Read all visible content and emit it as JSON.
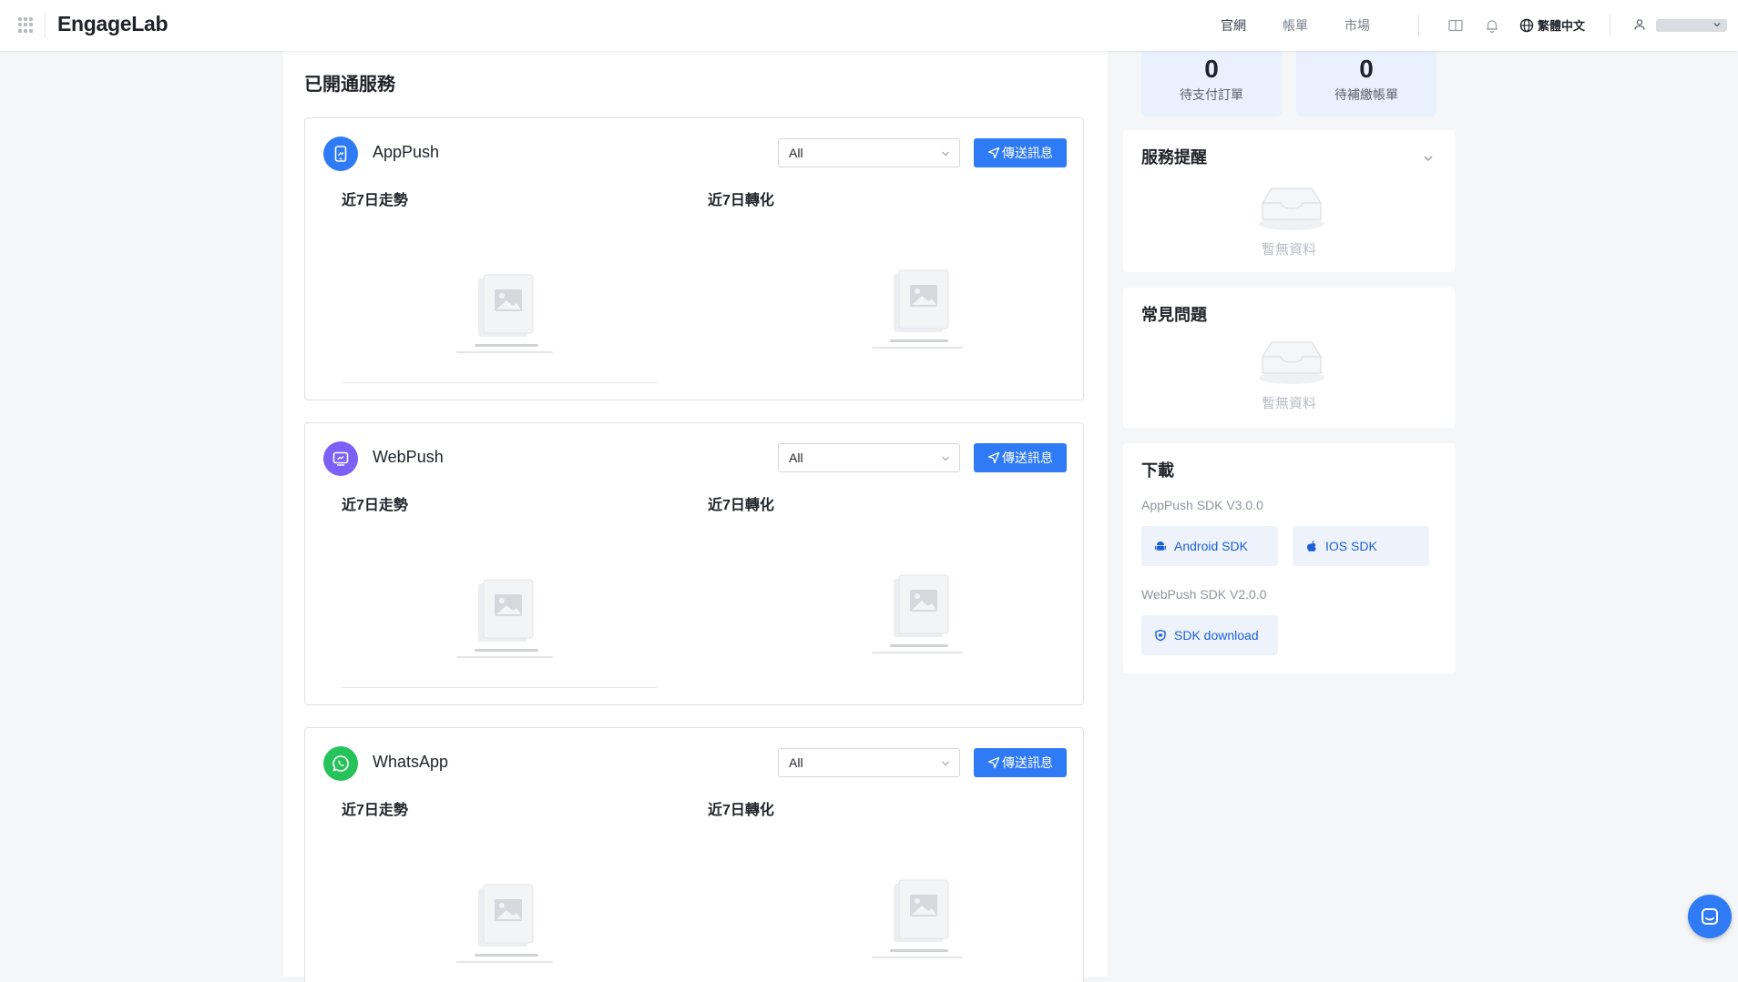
{
  "app": {
    "logo": "EngageLab"
  },
  "topbar": {
    "links": [
      "官網",
      "帳單",
      "市場"
    ],
    "language": "繁體中文",
    "icons": [
      "apps-grid-icon",
      "book-icon",
      "bell-icon",
      "globe-icon",
      "user-icon"
    ]
  },
  "main": {
    "title": "已開通服務",
    "services": [
      {
        "name": "AppPush",
        "icon": "apppush-icon",
        "color": "#2f7af5",
        "filter": "All",
        "send_label": "傳送訊息",
        "trend_label": "近7日走勢",
        "conversion_label": "近7日轉化"
      },
      {
        "name": "WebPush",
        "icon": "webpush-icon",
        "color": "#7b61f5",
        "filter": "All",
        "send_label": "傳送訊息",
        "trend_label": "近7日走勢",
        "conversion_label": "近7日轉化"
      },
      {
        "name": "WhatsApp",
        "icon": "whatsapp-icon",
        "color": "#25c35a",
        "filter": "All",
        "send_label": "傳送訊息",
        "trend_label": "近7日走勢",
        "conversion_label": "近7日轉化"
      }
    ]
  },
  "sidebar": {
    "kpis": [
      {
        "value": "0",
        "label": "待支付訂單"
      },
      {
        "value": "0",
        "label": "待補繳帳單"
      }
    ],
    "reminders": {
      "title": "服務提醒",
      "empty": "暫無資料"
    },
    "faq": {
      "title": "常見問題",
      "empty": "暫無資料"
    },
    "download": {
      "title": "下載",
      "apppush_sdk": "AppPush SDK V3.0.0",
      "android_label": "Android SDK",
      "ios_label": "IOS SDK",
      "webpush_sdk": "WebPush SDK V2.0.0",
      "sdk_download_label": "SDK download"
    }
  },
  "colors": {
    "accent": "#2f7af5",
    "kpi_bg": "#e8f1fd"
  }
}
